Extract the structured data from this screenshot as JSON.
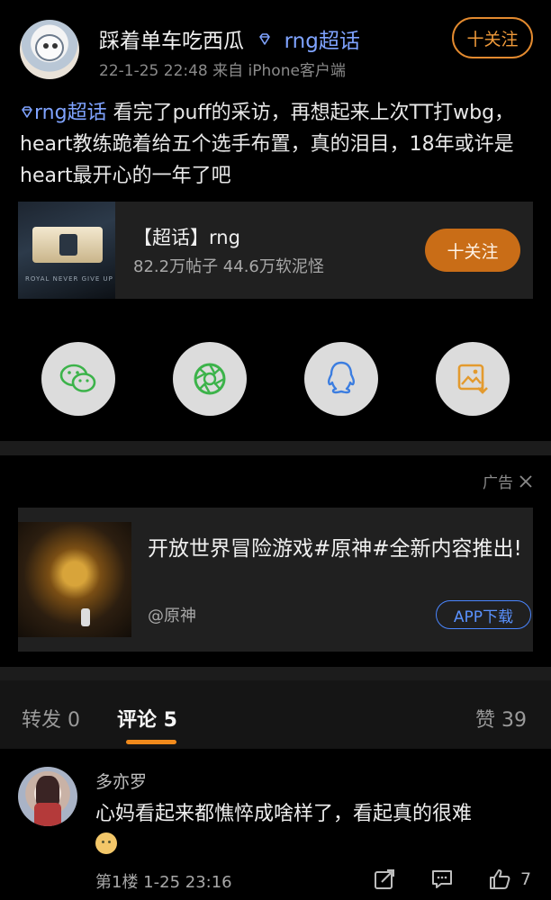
{
  "post": {
    "username": "踩着单车吃西瓜",
    "topic_tag": "rng超话",
    "meta": "22-1-25 22:48  来自 iPhone客户端",
    "follow_label": "十关注",
    "body_topic": "rng超话",
    "body_text": "  看完了puff的采访，再想起来上次TT打wbg，heart教练跪着给五个选手布置，真的泪目，18年或许是heart最开心的一年了吧"
  },
  "topic_card": {
    "title": "【超话】rng",
    "stats": "82.2万帖子 44.6万软泥怪",
    "follow_label": "十关注",
    "image_tagline": "ROYAL NEVER GIVE UP"
  },
  "share": {
    "icons": [
      "wechat-icon",
      "moments-icon",
      "qq-icon",
      "save-image-icon"
    ],
    "accent_colors": {
      "wechat": "#3cb34a",
      "moments": "#3cb34a",
      "qq": "#3b7de0",
      "save": "#e39a2e"
    }
  },
  "ad": {
    "label": "广告",
    "title": "开放世界冒险游戏#原神#全新内容推出!",
    "source": "@原神",
    "button_label": "APP下载"
  },
  "tabs": {
    "repost": "转发 0",
    "comments": "评论 5",
    "likes": "赞 39"
  },
  "comment": {
    "name": "多亦罗",
    "text": "心妈看起来都憔悴成啥样了，看起真的很难",
    "floor_time": "第1楼  1-25 23:16",
    "like_count": "7"
  },
  "colors": {
    "accent_orange": "#f08a1c",
    "link_blue": "#7fa3ff",
    "background": "#000000"
  }
}
